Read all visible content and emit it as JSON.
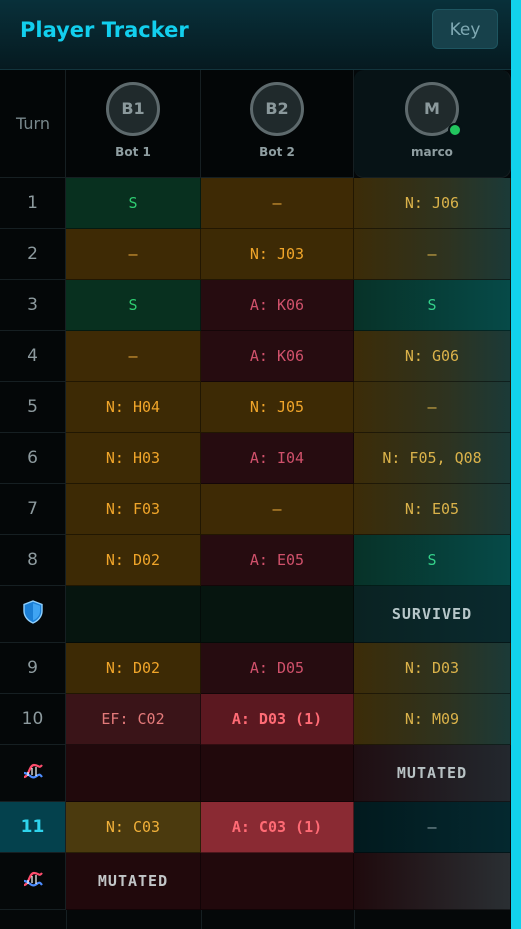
{
  "header": {
    "title": "Player Tracker",
    "key_label": "Key"
  },
  "columns": {
    "turn_label": "Turn",
    "players": [
      {
        "initials": "B1",
        "name": "Bot 1",
        "online": false
      },
      {
        "initials": "B2",
        "name": "Bot 2",
        "online": false
      },
      {
        "initials": "M",
        "name": "marco",
        "online": true
      }
    ]
  },
  "rows": [
    {
      "turn": "1",
      "cells": [
        "S",
        "—",
        "N: J06"
      ]
    },
    {
      "turn": "2",
      "cells": [
        "—",
        "N: J03",
        "—"
      ]
    },
    {
      "turn": "3",
      "cells": [
        "S",
        "A: K06",
        "S"
      ]
    },
    {
      "turn": "4",
      "cells": [
        "—",
        "A: K06",
        "N: G06"
      ]
    },
    {
      "turn": "5",
      "cells": [
        "N: H04",
        "N: J05",
        "—"
      ]
    },
    {
      "turn": "6",
      "cells": [
        "N: H03",
        "A: I04",
        "N: F05, Q08"
      ]
    },
    {
      "turn": "7",
      "cells": [
        "N: F03",
        "—",
        "N: E05"
      ]
    },
    {
      "turn": "8",
      "cells": [
        "N: D02",
        "A: E05",
        "S"
      ]
    },
    {
      "event": "shield-icon",
      "label": "SURVIVED"
    },
    {
      "turn": "9",
      "cells": [
        "N: D02",
        "A: D05",
        "N: D03"
      ]
    },
    {
      "turn": "10",
      "cells": [
        "EF: C02",
        "A: D03 (1)",
        "N: M09"
      ]
    },
    {
      "event": "dna-icon",
      "label": "MUTATED"
    },
    {
      "turn": "11",
      "current": true,
      "cells": [
        "N: C03",
        "A: C03 (1)",
        "—"
      ]
    },
    {
      "event": "dna-icon",
      "label": "MUTATED"
    }
  ],
  "colors": {
    "accent": "#12cfee",
    "survived": "#2ecc71",
    "neutral": "#f0a52a",
    "attack": "#d0516b",
    "online": "#22c55e"
  }
}
